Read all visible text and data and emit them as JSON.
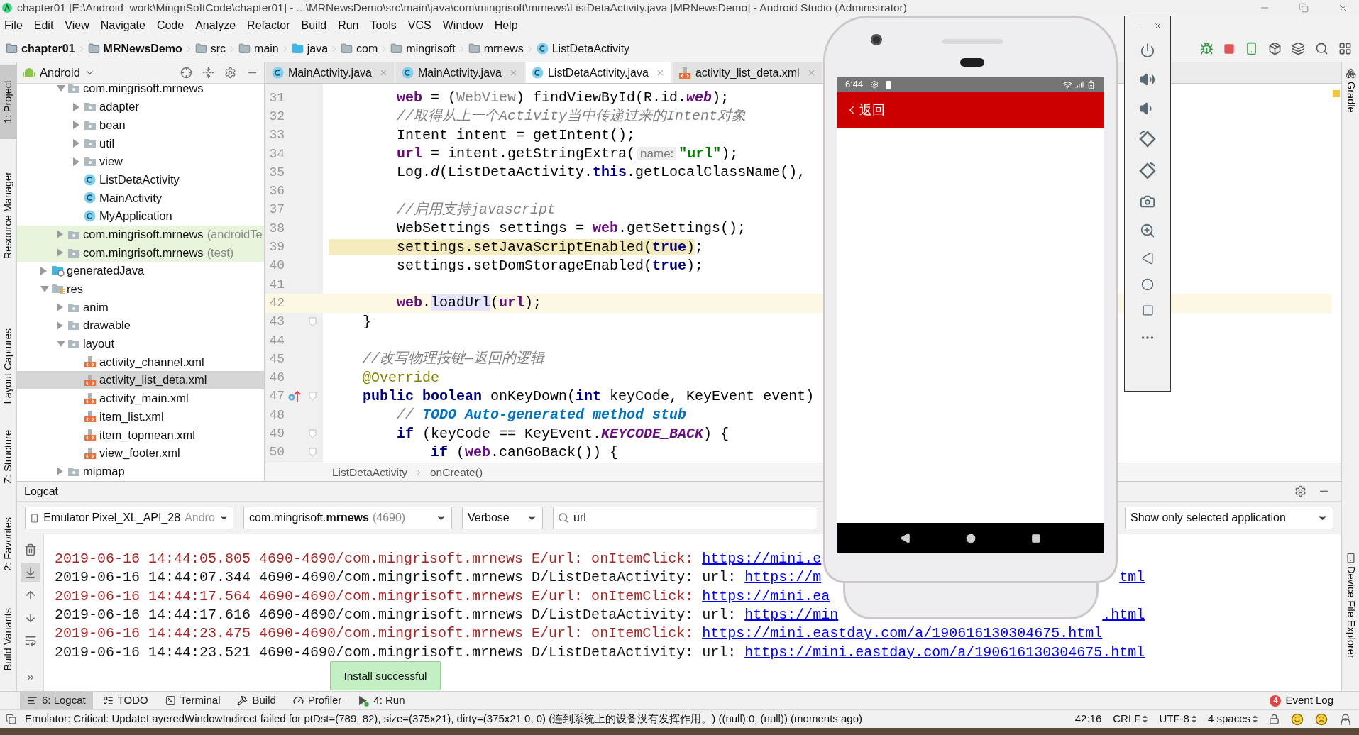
{
  "title_bar": {
    "title": "chapter01 [E:\\Android_work\\MingriSoftCode\\chapter01] - ...\\MRNewsDemo\\src\\main\\java\\com\\mingrisoft\\mrnews\\ListDetaActivity.java [MRNewsDemo] - Android Studio (Administrator)"
  },
  "menu": [
    "File",
    "Edit",
    "View",
    "Navigate",
    "Code",
    "Analyze",
    "Refactor",
    "Build",
    "Run",
    "Tools",
    "VCS",
    "Window",
    "Help"
  ],
  "breadcrumbs": [
    {
      "label": "chapter01",
      "kind": "project"
    },
    {
      "label": "MRNewsDemo",
      "kind": "module"
    },
    {
      "label": "src",
      "kind": "folder"
    },
    {
      "label": "main",
      "kind": "folder"
    },
    {
      "label": "java",
      "kind": "source"
    },
    {
      "label": "com",
      "kind": "folder"
    },
    {
      "label": "mingrisoft",
      "kind": "folder"
    },
    {
      "label": "mrnews",
      "kind": "folder"
    },
    {
      "label": "ListDetaActivity",
      "kind": "class"
    }
  ],
  "left_stripe": [
    {
      "label": "1: Project",
      "selected": true
    },
    {
      "label": "Resource Manager",
      "selected": false
    },
    {
      "label": "Layout Captures",
      "selected": false
    },
    {
      "label": "Z: Structure",
      "selected": false
    },
    {
      "label": "2: Favorites",
      "selected": false
    },
    {
      "label": "Build Variants",
      "selected": false
    }
  ],
  "right_stripe": [
    {
      "label": "Gradle"
    },
    {
      "label": "Device File Explorer"
    }
  ],
  "project": {
    "view": "Android",
    "tree": [
      {
        "children": [
          {
            "children": [
              {
                "label": "com.mingrisoft.mrnews",
                "kind": "package",
                "expanded": true,
                "selected": false,
                "children": [
                  {
                    "label": "adapter",
                    "kind": "package",
                    "expanded": false,
                    "selected": false
                  },
                  {
                    "label": "bean",
                    "kind": "package",
                    "expanded": false,
                    "selected": false
                  },
                  {
                    "label": "util",
                    "kind": "package",
                    "expanded": false,
                    "selected": false
                  },
                  {
                    "label": "view",
                    "kind": "package",
                    "expanded": false,
                    "selected": false
                  },
                  {
                    "label": "ListDetaActivity",
                    "kind": "class",
                    "selected": false
                  },
                  {
                    "label": "MainActivity",
                    "kind": "class",
                    "selected": false
                  },
                  {
                    "label": "MyApplication",
                    "kind": "class",
                    "selected": false
                  }
                ]
              },
              {
                "label": "com.mingrisoft.mrnews",
                "suffix": "(androidTe",
                "kind": "test_package",
                "expanded": false,
                "selected": false
              },
              {
                "label": "com.mingrisoft.mrnews",
                "suffix": "(test)",
                "kind": "test_package",
                "expanded": false,
                "selected": false
              }
            ]
          },
          {
            "label": "generatedJava",
            "kind": "generated",
            "expanded": false,
            "selected": false
          },
          {
            "label": "res",
            "kind": "res",
            "expanded": true,
            "selected": false,
            "children": [
              {
                "label": "anim",
                "kind": "package",
                "expanded": false,
                "selected": false
              },
              {
                "label": "drawable",
                "kind": "package",
                "expanded": false,
                "selected": false
              },
              {
                "label": "layout",
                "kind": "package",
                "expanded": true,
                "selected": false,
                "children": [
                  {
                    "label": "activity_channel.xml",
                    "kind": "xml",
                    "selected": false
                  },
                  {
                    "label": "activity_list_deta.xml",
                    "kind": "xml",
                    "selected": true
                  },
                  {
                    "label": "activity_main.xml",
                    "kind": "xml",
                    "selected": false
                  },
                  {
                    "label": "item_list.xml",
                    "kind": "xml",
                    "selected": false
                  },
                  {
                    "label": "item_topmean.xml",
                    "kind": "xml",
                    "selected": false
                  },
                  {
                    "label": "view_footer.xml",
                    "kind": "xml",
                    "selected": false
                  }
                ]
              },
              {
                "label": "mipmap",
                "kind": "package",
                "expanded": false,
                "selected": false
              }
            ]
          }
        ]
      }
    ]
  },
  "editor_tabs": [
    {
      "label": "MainActivity.java",
      "kind": "class",
      "selected": false
    },
    {
      "label": "MainActivity.java",
      "kind": "class",
      "selected": false
    },
    {
      "label": "ListDetaActivity.java",
      "kind": "class",
      "selected": true
    },
    {
      "label": "activity_list_deta.xml",
      "kind": "xml",
      "selected": false
    }
  ],
  "code": [
    {
      "number": "31",
      "current": false,
      "fold": false,
      "override": false,
      "tokens": [
        {
          "kind": "field",
          "text": "        web"
        },
        {
          "kind": "plain",
          "text": " = ("
        },
        {
          "kind": "muted",
          "text": "WebView"
        },
        {
          "kind": "plain",
          "text": ") findViewById(R.id."
        },
        {
          "kind": "static",
          "text": "web"
        },
        {
          "kind": "plain",
          "text": ");"
        }
      ]
    },
    {
      "number": "32",
      "current": false,
      "fold": false,
      "override": false,
      "tokens": [
        {
          "kind": "comment",
          "text": "        //取得从上一个Activity当中传递过来的Intent对象"
        }
      ]
    },
    {
      "number": "33",
      "current": false,
      "fold": false,
      "override": false,
      "tokens": [
        {
          "kind": "plain",
          "text": "        Intent intent = getIntent();"
        }
      ]
    },
    {
      "number": "34",
      "current": false,
      "fold": false,
      "override": false,
      "tokens": [
        {
          "kind": "field",
          "text": "        url"
        },
        {
          "kind": "plain",
          "text": " = intent.getStringExtra("
        },
        {
          "kind": "hint",
          "text": "name:"
        },
        {
          "kind": "string",
          "text": "\"url\""
        },
        {
          "kind": "plain",
          "text": ");"
        }
      ]
    },
    {
      "number": "35",
      "current": false,
      "fold": false,
      "override": false,
      "tokens": [
        {
          "kind": "plain",
          "text": "        Log."
        },
        {
          "kind": "italic",
          "text": "d"
        },
        {
          "kind": "plain",
          "text": "(ListDetaActivity."
        },
        {
          "kind": "kw",
          "text": "this"
        },
        {
          "kind": "plain",
          "text": ".getLocalClassName(),"
        }
      ]
    },
    {
      "number": "36",
      "current": false,
      "fold": false,
      "override": false
    },
    {
      "number": "37",
      "current": false,
      "fold": false,
      "override": false,
      "tokens": [
        {
          "kind": "comment",
          "text": "        //启用支持javascript"
        }
      ]
    },
    {
      "number": "38",
      "current": false,
      "fold": false,
      "override": false,
      "tokens": [
        {
          "kind": "plain",
          "text": "        WebSettings settings = "
        },
        {
          "kind": "field",
          "text": "web"
        },
        {
          "kind": "plain",
          "text": ".getSettings();"
        }
      ]
    },
    {
      "number": "39",
      "current": false,
      "fold": false,
      "override": false,
      "tokens": [
        {
          "kind": "warn",
          "text": "        settings.setJavaScriptEnabled("
        },
        {
          "kind": "kw_warn",
          "text": "true"
        },
        {
          "kind": "warn",
          "text": ")"
        },
        {
          "kind": "plain",
          "text": ";"
        }
      ]
    },
    {
      "number": "40",
      "current": false,
      "fold": false,
      "override": false,
      "tokens": [
        {
          "kind": "plain",
          "text": "        settings.setDomStorageEnabled("
        },
        {
          "kind": "kw",
          "text": "true"
        },
        {
          "kind": "plain",
          "text": ");"
        }
      ]
    },
    {
      "number": "41",
      "current": false,
      "fold": false,
      "override": false
    },
    {
      "number": "42",
      "current": true,
      "fold": false,
      "override": false,
      "tokens": [
        {
          "kind": "field",
          "text": "        web"
        },
        {
          "kind": "plain",
          "text": "."
        },
        {
          "kind": "usage",
          "text": "loadUrl"
        },
        {
          "kind": "plain",
          "text": "("
        },
        {
          "kind": "field",
          "text": "url"
        },
        {
          "kind": "plain",
          "text": ");"
        }
      ]
    },
    {
      "number": "43",
      "current": false,
      "fold": true,
      "override": false,
      "tokens": [
        {
          "kind": "plain",
          "text": "    }"
        }
      ]
    },
    {
      "number": "44",
      "current": false,
      "fold": false,
      "override": false
    },
    {
      "number": "45",
      "current": false,
      "fold": false,
      "override": false,
      "tokens": [
        {
          "kind": "comment",
          "text": "    //改写物理按键—返回的逻辑"
        }
      ]
    },
    {
      "number": "46",
      "current": false,
      "fold": false,
      "override": false,
      "tokens": [
        {
          "kind": "annotation",
          "text": "    @Override"
        }
      ]
    },
    {
      "number": "47",
      "current": false,
      "fold": true,
      "override": true,
      "tokens": [
        {
          "kind": "kw",
          "text": "    public boolean"
        },
        {
          "kind": "plain",
          "text": " onKeyDown("
        },
        {
          "kind": "kw",
          "text": "int"
        },
        {
          "kind": "plain",
          "text": " keyCode, KeyEvent event)"
        }
      ]
    },
    {
      "number": "48",
      "current": false,
      "fold": false,
      "override": false,
      "tokens": [
        {
          "kind": "comment",
          "text": "        // "
        },
        {
          "kind": "todo",
          "text": "TODO Auto-generated method stub"
        }
      ]
    },
    {
      "number": "49",
      "current": false,
      "fold": true,
      "override": false,
      "tokens": [
        {
          "kind": "kw",
          "text": "        if"
        },
        {
          "kind": "plain",
          "text": " (keyCode == KeyEvent."
        },
        {
          "kind": "static",
          "text": "KEYCODE_BACK"
        },
        {
          "kind": "plain",
          "text": ") {"
        }
      ]
    },
    {
      "number": "50",
      "current": false,
      "fold": true,
      "override": false,
      "tokens": [
        {
          "kind": "kw",
          "text": "            if"
        },
        {
          "kind": "plain",
          "text": " ("
        },
        {
          "kind": "field",
          "text": "web"
        },
        {
          "kind": "plain",
          "text": ".canGoBack()) {"
        }
      ]
    }
  ],
  "editor_breadcrumb": [
    "ListDetaActivity",
    "onCreate()"
  ],
  "logcat": {
    "title": "Logcat",
    "device": {
      "value": "Emulator Pixel_XL_API_28",
      "suffix": "Andro"
    },
    "process": {
      "package": "com.mingrisoft.",
      "app": "mrnews",
      "pid": "(4690)"
    },
    "log_level": "Verbose",
    "search": {
      "value": "url"
    },
    "filter": "Show only selected application",
    "tools": [
      {
        "kind": "clear",
        "selected": false
      },
      {
        "kind": "scroll_end",
        "selected": true
      },
      {
        "kind": "up",
        "selected": false
      },
      {
        "kind": "down",
        "selected": false
      },
      {
        "kind": "wrap",
        "selected": false
      },
      {
        "kind": "more",
        "selected": false
      }
    ],
    "lines": [
      {
        "kind": "error",
        "text": "2019-06-16 14:44:05.805 4690-4690/com.mingrisoft.mrnews E/url: onItemClick: ",
        "url": "https://mini.e"
      },
      {
        "kind": "debug",
        "text": "2019-06-16 14:44:07.344 4690-4690/com.mingrisoft.mrnews D/ListDetaActivity: url: ",
        "url": "https://m",
        "tail": "tml"
      },
      {
        "kind": "error",
        "text": "2019-06-16 14:44:17.564 4690-4690/com.mingrisoft.mrnews E/url: onItemClick: ",
        "url": "https://mini.ea"
      },
      {
        "kind": "debug",
        "text": "2019-06-16 14:44:17.616 4690-4690/com.mingrisoft.mrnews D/ListDetaActivity: url: ",
        "url": "https://min",
        "tail": ".html"
      },
      {
        "kind": "error",
        "text": "2019-06-16 14:44:23.475 4690-4690/com.mingrisoft.mrnews E/url: onItemClick: ",
        "url": "https://mini.eastday.com/a/190616130304675.html"
      },
      {
        "kind": "debug",
        "text": "2019-06-16 14:44:23.521 4690-4690/com.mingrisoft.mrnews D/ListDetaActivity: url: ",
        "url": "https://mini.eastday.com/a/190616130304675.html"
      }
    ]
  },
  "balloon": "Install successful",
  "tool_tabs": [
    {
      "label": "6: Logcat",
      "kind": "logcat",
      "selected": true
    },
    {
      "label": "TODO",
      "kind": "todo",
      "selected": false
    },
    {
      "label": "Terminal",
      "kind": "terminal",
      "selected": false
    },
    {
      "label": "Build",
      "kind": "build",
      "selected": false
    },
    {
      "label": "Profiler",
      "kind": "profiler",
      "selected": false
    },
    {
      "label": "4: Run",
      "kind": "run",
      "selected": false
    }
  ],
  "event_log": {
    "label": "Event Log",
    "count": "4"
  },
  "status_bar": {
    "message": "Emulator: Critical: UpdateLayeredWindowIndirect failed for ptDst=(789, 82), size=(375x21), dirty=(375x21 0, 0) (连到系统上的设备没有发挥作用。) ((null):0, (null)) (moments ago)",
    "items": [
      {
        "label": "42:16",
        "kind": "text"
      },
      {
        "label": "CRLF",
        "kind": "select"
      },
      {
        "label": "UTF-8",
        "kind": "select"
      },
      {
        "label": "4 spaces",
        "kind": "select"
      }
    ]
  },
  "emulator": {
    "time": "6:44",
    "back_label": "返回"
  }
}
